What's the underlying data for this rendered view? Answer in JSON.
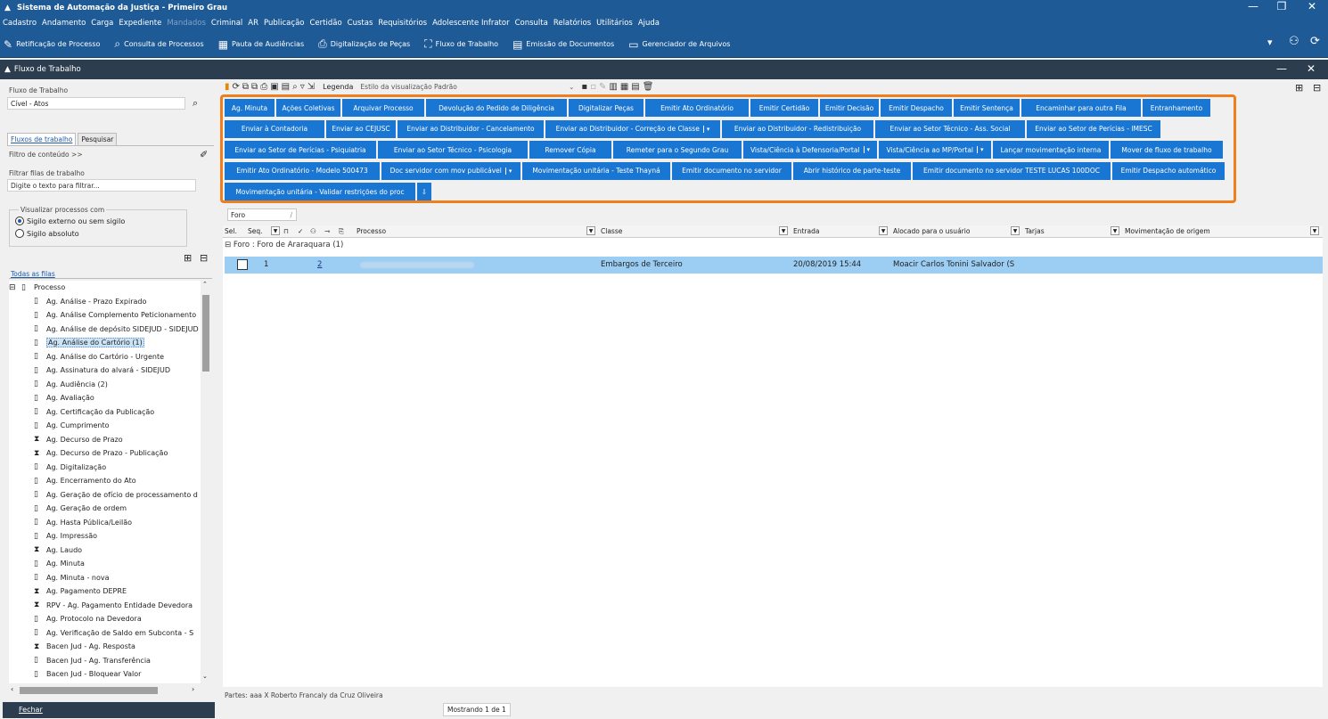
{
  "window": {
    "title": "Sistema de Automação da Justiça - Primeiro Grau",
    "minimize": "—",
    "restore": "❐",
    "close": "✕"
  },
  "menu": [
    {
      "label": "Cadastro"
    },
    {
      "label": "Andamento"
    },
    {
      "label": "Carga"
    },
    {
      "label": "Expediente"
    },
    {
      "label": "Mandados",
      "disabled": true
    },
    {
      "label": "Criminal"
    },
    {
      "label": "AR"
    },
    {
      "label": "Publicação"
    },
    {
      "label": "Certidão"
    },
    {
      "label": "Custas"
    },
    {
      "label": "Requisitórios"
    },
    {
      "label": "Adolescente Infrator"
    },
    {
      "label": "Consulta"
    },
    {
      "label": "Relatórios"
    },
    {
      "label": "Utilitários"
    },
    {
      "label": "Ajuda"
    }
  ],
  "toolbar": [
    {
      "label": "Retificação de Processo",
      "icon": "✎"
    },
    {
      "label": "Consulta de Processos",
      "icon": "⌕"
    },
    {
      "label": "Pauta de Audiências",
      "icon": "▦"
    },
    {
      "label": "Digitalização de Peças",
      "icon": "⎙"
    },
    {
      "label": "Fluxo de Trabalho",
      "icon": "⛶"
    },
    {
      "label": "Emissão de Documentos",
      "icon": "▤"
    },
    {
      "label": "Gerenciador de Arquivos",
      "icon": "▭"
    }
  ],
  "panel": {
    "title": "Fluxo de Trabalho",
    "minimize": "—",
    "close": "✕"
  },
  "left": {
    "fluxo_label": "Fluxo de Trabalho",
    "fluxo_value": "Cível - Atos",
    "tabs": [
      "Fluxos de trabalho",
      "Pesquisar"
    ],
    "filtro_conteudo": "Filtro de conteúdo >>",
    "filtrar_filas_label": "Filtrar filas de trabalho",
    "filtrar_placeholder": "Digite o texto para filtrar...",
    "visualizar_label": "Visualizar processos com",
    "radio1": "Sigilo externo ou sem sigilo",
    "radio2": "Sigilo absoluto",
    "todas_filas": "Todas as filas",
    "tree_root": "Processo",
    "tree_items": [
      "Ag. Análise - Prazo Expirado",
      "Ag. Análise Complemento Peticionamento",
      "Ag. Análise de depósito SIDEJUD - SIDEJUD",
      "Ag. Análise do Cartório (1)",
      "Ag. Análise do Cartório - Urgente",
      "Ag. Assinatura do alvará - SIDEJUD",
      "Ag. Audiência (2)",
      "Ag. Avaliação",
      "Ag. Certificação da Publicação",
      "Ag. Cumprimento",
      "Ag. Decurso de Prazo",
      "Ag. Decurso de Prazo - Publicação",
      "Ag. Digitalização",
      "Ag. Encerramento do Ato",
      "Ag. Geração de ofício de processamento d",
      "Ag. Geração de ordem",
      "Ag. Hasta Pública/Leilão",
      "Ag. Impressão",
      "Ag. Laudo",
      "Ag. Minuta",
      "Ag. Minuta - nova",
      "Ag. Pagamento DEPRE",
      "RPV - Ag. Pagamento Entidade Devedora",
      "Ag. Protocolo na Devedora",
      "Ag. Verificação de Saldo em Subconta - S",
      "Bacen Jud - Ag. Resposta",
      "Bacen Jud - Ag. Transferência",
      "Bacen Jud - Bloquear Valor"
    ],
    "fechar": "Fechar"
  },
  "main": {
    "legenda": "Legenda",
    "estilo": "Estilo da visualização Padrão",
    "button_rows": [
      [
        "Ag. Minuta",
        "Ações Coletivas",
        "Arquivar Processo",
        "Devolução do Pedido de Diligência",
        "Digitalizar Peças",
        "Emitir Ato Ordinatório",
        "Emitir Certidão",
        "Emitir Decisão",
        "Emitir Despacho",
        "Emitir Sentença",
        "Encaminhar para outra Fila",
        "Entranhamento"
      ],
      [
        "Enviar à Contadoria",
        "Enviar ao CEJUSC",
        "Enviar ao Distribuidor - Cancelamento",
        "Enviar ao Distribuidor - Correção de Classe",
        "Enviar ao Distribuidor - Redistribuição",
        "Enviar ao Setor Técnico - Ass. Social",
        "Enviar ao Setor de Perícias - IMESC"
      ],
      [
        "Enviar ao Setor de Perícias - Psiquiatria",
        "Enviar ao Setor Técnico - Psicologia",
        "Remover Cópia",
        "Remeter para o Segundo Grau",
        "Vista/Ciência à Defensoria/Portal",
        "Vista/Ciência ao MP/Portal",
        "Lançar movimentação interna",
        "Mover de fluxo de trabalho"
      ],
      [
        "Emitir Ato Ordinatório - Modelo 500473",
        "Doc servidor com mov publicável",
        "Movimentação unitária - Teste Thayná",
        "Emitir documento no servidor",
        "Abrir histórico de parte-teste",
        "Emitir documento no servidor TESTE LUCAS 100DOC",
        "Emitir Despacho automático"
      ],
      [
        "Movimentação unitária - Validar restrições do proc"
      ]
    ],
    "filter_chip": "Foro",
    "columns": [
      "Sel.",
      "Seq.",
      "Processo",
      "Classe",
      "Entrada",
      "Alocado para o usuário",
      "Tarjas",
      "Movimentação de origem"
    ],
    "group_label": "Foro : Foro de Araraquara  (1)",
    "row": {
      "seq": "1",
      "link": "2",
      "classe": "Embargos de Terceiro",
      "entrada": "20/08/2019 15:44",
      "alocado": "Moacir Carlos Tonini Salvador (S"
    },
    "partes": "Partes: aaa  X  Roberto Francaly da Cruz Oliveira",
    "mostrando": "Mostrando 1 de 1"
  }
}
